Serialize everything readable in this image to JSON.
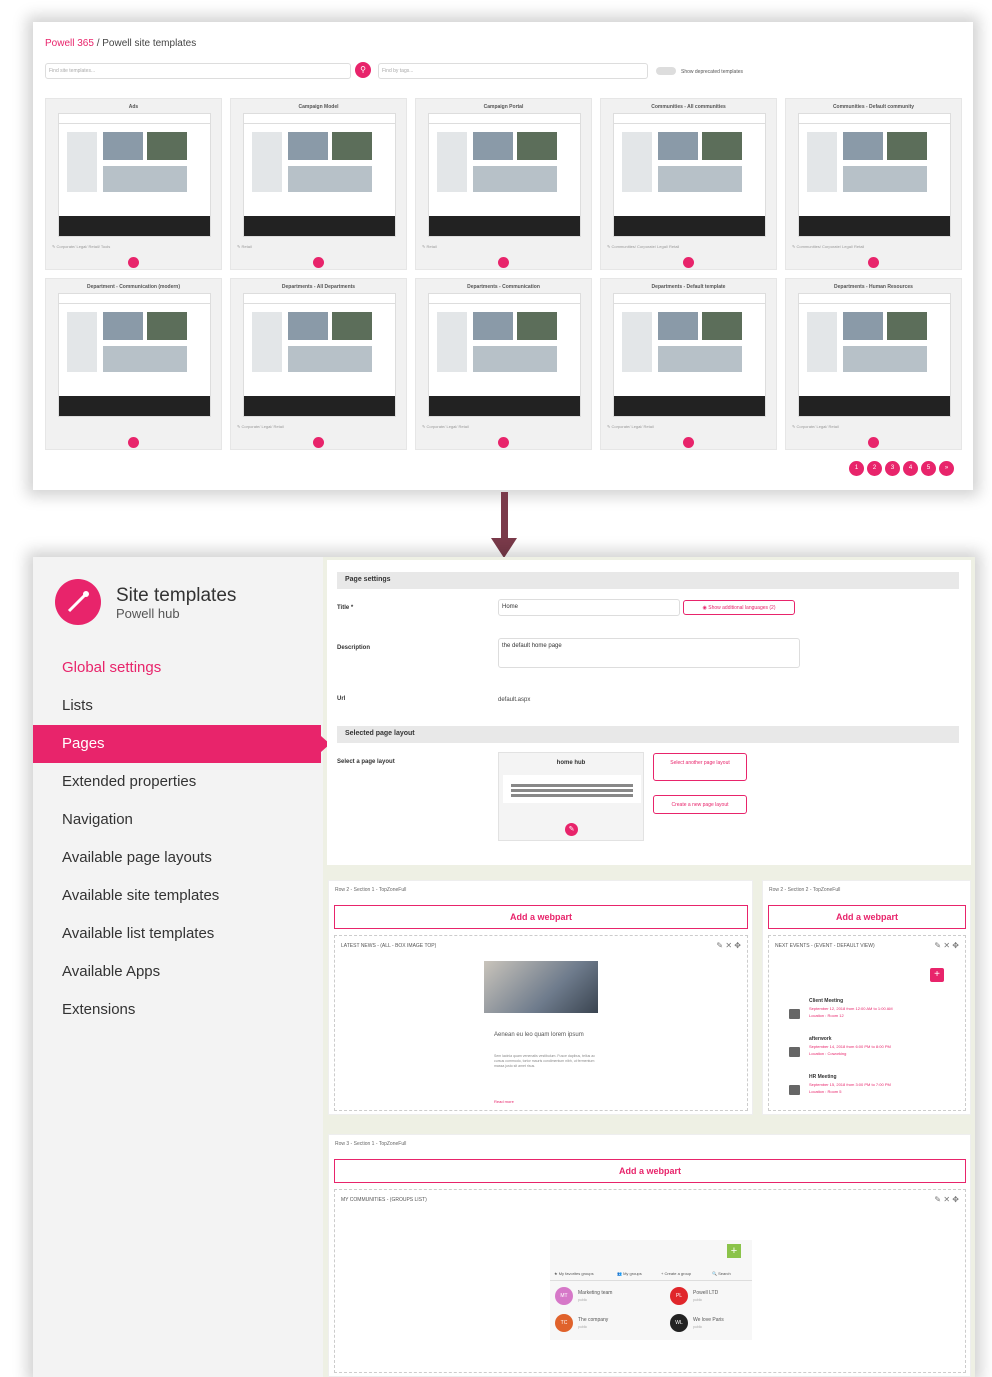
{
  "top": {
    "breadcrumb_link": "Powell 365",
    "breadcrumb_sep": " / ",
    "breadcrumb_page": "Powell site templates",
    "search_placeholder": "Find site templates...",
    "tags_placeholder": "Find by tags...",
    "deprecated_label": "Show deprecated templates",
    "cards": [
      {
        "title": "Ads",
        "tags": "✎ Corporate/ Legal/ Retail/ Tools"
      },
      {
        "title": "Campaign Model",
        "tags": "✎ Retail"
      },
      {
        "title": "Campaign Portal",
        "tags": "✎ Retail"
      },
      {
        "title": "Communities - All communities",
        "tags": "✎ Communities/ Corporate/ Legal/ Retail"
      },
      {
        "title": "Communities - Default community",
        "tags": "✎ Communities/ Corporate/ Legal/ Retail"
      },
      {
        "title": "Department - Communication (modern)",
        "tags": ""
      },
      {
        "title": "Departments - All Departments",
        "tags": "✎ Corporate/ Legal/ Retail"
      },
      {
        "title": "Departments - Communication",
        "tags": "✎ Corporate/ Legal/ Retail"
      },
      {
        "title": "Departments - Default template",
        "tags": "✎ Corporate/ Legal/ Retail"
      },
      {
        "title": "Departments - Human Resources",
        "tags": "✎ Corporate/ Legal/ Retail"
      }
    ],
    "pages": [
      "1",
      "2",
      "3",
      "4",
      "5",
      "»"
    ]
  },
  "side": {
    "title": "Site templates",
    "subtitle": "Powell hub",
    "nav": [
      "Global settings",
      "Lists",
      "Pages",
      "Extended properties",
      "Navigation",
      "Available page layouts",
      "Available site templates",
      "Available list templates",
      "Available Apps",
      "Extensions"
    ]
  },
  "main": {
    "page_settings": "Page settings",
    "title_label": "Title *",
    "title_value": "Home",
    "show_lang": "Show additional languages (2)",
    "desc_label": "Description",
    "desc_value": "the default home page",
    "url_label": "Url",
    "url_value": "default.aspx",
    "selected_layout": "Selected page layout",
    "select_label": "Select a page layout",
    "layout_name": "home hub",
    "select_another": "Select another page layout",
    "create_new": "Create a new page layout"
  },
  "zones": {
    "z1_title": "Row 2 - Section 1 - TopZoneFull",
    "z2_title": "Row 2 - Section 2 - TopZoneFull",
    "z3_title": "Row 3 - Section 1 - TopZoneFull",
    "add_webpart": "Add a webpart",
    "news_title": "LATEST NEWS - (ALL - BOX IMAGE TOP)",
    "news_headline": "Aenean eu leo quam lorem ipsum",
    "news_body": "Sem lacinia quam venenatis vestibulum. Fusce dapibus, tellus ac cursus commodo, tortor mauris condimentum nibh, ut fermentum massa justo sit amet risus.",
    "news_more": "Read more",
    "events_title": "NEXT EVENTS - (EVENT - DEFAULT VIEW)",
    "events": [
      {
        "name": "Client Meeting",
        "date": "September 12, 2018 from 12:00 AM to 1:00 AM",
        "loc": "Location : Room 12"
      },
      {
        "name": "afterwork",
        "date": "September 14, 2018 from 6:00 PM to 8:00 PM",
        "loc": "Location : Coworking"
      },
      {
        "name": "HR Meeting",
        "date": "September 15, 2018 from 3:00 PM to 7:00 PM",
        "loc": "Location : Room 5"
      }
    ],
    "comm_title": "MY COMMUNITIES - (GROUPS LIST)",
    "comm_tabs": [
      "★ My favorites groups",
      "👥 My groups",
      "+ Create a group",
      "🔍 Search"
    ],
    "groups": [
      {
        "initials": "MT",
        "name": "Marketing team",
        "color": "#d678c8"
      },
      {
        "initials": "PL",
        "name": "Powell LTD",
        "color": "#e0262b"
      },
      {
        "initials": "TC",
        "name": "The company",
        "color": "#e0622b"
      },
      {
        "initials": "WL",
        "name": "We love Paris",
        "color": "#222222"
      }
    ],
    "public": "public"
  }
}
